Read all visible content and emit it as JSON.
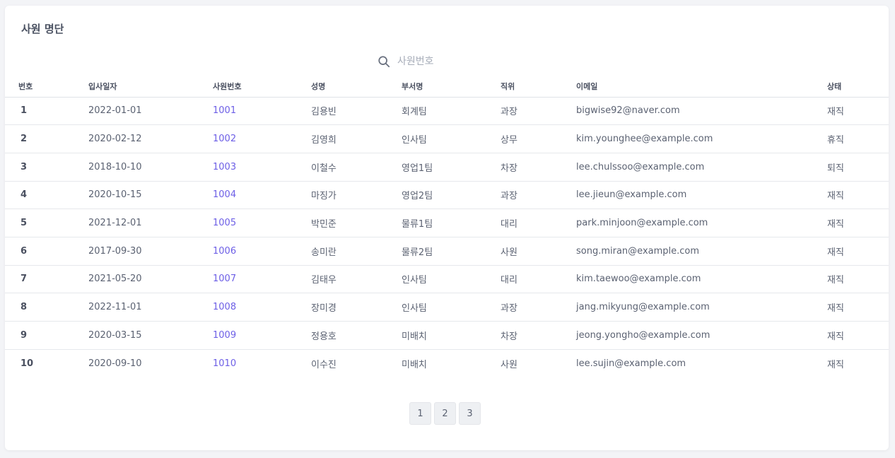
{
  "page": {
    "title": "사원 명단"
  },
  "search": {
    "placeholder": "사원번호",
    "value": "",
    "icon": "search-icon"
  },
  "table": {
    "headers": {
      "no": "번호",
      "hire_date": "입사일자",
      "emp_no": "사원번호",
      "name": "성명",
      "dept": "부서명",
      "position": "직위",
      "email": "이메일",
      "status": "상태"
    },
    "rows": [
      {
        "no": "1",
        "hire_date": "2022-01-01",
        "emp_no": "1001",
        "name": "김용빈",
        "dept": "회계팀",
        "position": "과장",
        "email": "bigwise92@naver.com",
        "status": "재직"
      },
      {
        "no": "2",
        "hire_date": "2020-02-12",
        "emp_no": "1002",
        "name": "김영희",
        "dept": "인사팀",
        "position": "상무",
        "email": "kim.younghee@example.com",
        "status": "휴직"
      },
      {
        "no": "3",
        "hire_date": "2018-10-10",
        "emp_no": "1003",
        "name": "이철수",
        "dept": "영업1팀",
        "position": "차장",
        "email": "lee.chulssoo@example.com",
        "status": "퇴직"
      },
      {
        "no": "4",
        "hire_date": "2020-10-15",
        "emp_no": "1004",
        "name": "마징가",
        "dept": "영업2팀",
        "position": "과장",
        "email": "lee.jieun@example.com",
        "status": "재직"
      },
      {
        "no": "5",
        "hire_date": "2021-12-01",
        "emp_no": "1005",
        "name": "박민준",
        "dept": "물류1팀",
        "position": "대리",
        "email": "park.minjoon@example.com",
        "status": "재직"
      },
      {
        "no": "6",
        "hire_date": "2017-09-30",
        "emp_no": "1006",
        "name": "송미란",
        "dept": "물류2팀",
        "position": "사원",
        "email": "song.miran@example.com",
        "status": "재직"
      },
      {
        "no": "7",
        "hire_date": "2021-05-20",
        "emp_no": "1007",
        "name": "김태우",
        "dept": "인사팀",
        "position": "대리",
        "email": "kim.taewoo@example.com",
        "status": "재직"
      },
      {
        "no": "8",
        "hire_date": "2022-11-01",
        "emp_no": "1008",
        "name": "장미경",
        "dept": "인사팀",
        "position": "과장",
        "email": "jang.mikyung@example.com",
        "status": "재직"
      },
      {
        "no": "9",
        "hire_date": "2020-03-15",
        "emp_no": "1009",
        "name": "정용호",
        "dept": "미배치",
        "position": "차장",
        "email": "jeong.yongho@example.com",
        "status": "재직"
      },
      {
        "no": "10",
        "hire_date": "2020-09-10",
        "emp_no": "1010",
        "name": "이수진",
        "dept": "미배치",
        "position": "사원",
        "email": "lee.sujin@example.com",
        "status": "재직"
      }
    ]
  },
  "pagination": {
    "pages": [
      "1",
      "2",
      "3"
    ]
  },
  "colors": {
    "link": "#6d5fe6",
    "background": "#f3f4f7",
    "card": "#ffffff"
  }
}
